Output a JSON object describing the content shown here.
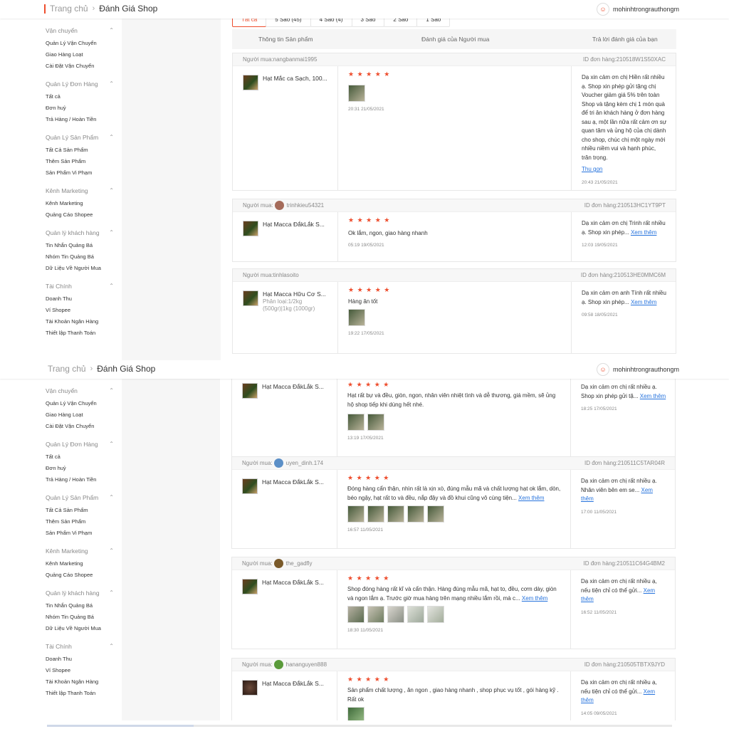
{
  "breadcrumb": {
    "home": "Trang chủ",
    "current": "Đánh Giá Shop"
  },
  "user": {
    "name": "mohinhtrongrauthongm"
  },
  "sidebar": [
    {
      "title": "Vận chuyển",
      "items": [
        "Quản Lý Vận Chuyển",
        "Giao Hàng Loạt",
        "Cài Đặt Vận Chuyển"
      ]
    },
    {
      "title": "Quản Lý Đơn Hàng",
      "items": [
        "Tất cả",
        "Đơn huỷ",
        "Trả Hàng / Hoàn Tiền"
      ]
    },
    {
      "title": "Quản Lý Sản Phẩm",
      "items": [
        "Tất Cả Sản Phẩm",
        "Thêm Sản Phẩm",
        "Sản Phẩm Vi Phạm"
      ]
    },
    {
      "title": "Kênh Marketing",
      "items": [
        "Kênh Marketing",
        "Quảng Cáo Shopee"
      ]
    },
    {
      "title": "Quản lý khách hàng",
      "items": [
        "Tin Nhắn Quảng Bá",
        "Nhóm Tin Quảng Bá",
        "Dữ Liệu Về Người Mua"
      ]
    },
    {
      "title": "Tài Chính",
      "items": [
        "Doanh Thu",
        "Ví Shopee",
        "Tài Khoản Ngân Hàng",
        "Thiết lập Thanh Toán"
      ]
    }
  ],
  "tabs": [
    "Tất cả",
    "5 Sao (45)",
    "4 Sao (4)",
    "3 Sao",
    "2 Sao",
    "1 Sao"
  ],
  "table_header": {
    "product": "Thông tin Sản phẩm",
    "buyer_review": "Đánh giá của Người mua",
    "reply": "Trả lời đánh giá của bạn"
  },
  "stars": "★ ★ ★ ★ ★",
  "more_label": "Xem thêm",
  "collapse_label": "Thu gọn",
  "reviews_top": [
    {
      "buyer": "Người mua:nangbanmai1995",
      "order": "ID đơn hàng:210518W1S50XAC",
      "product": "Hạt Mắc ca Sạch, 100...",
      "variant": "",
      "comment": "",
      "comment_more": false,
      "images": 1,
      "time": "20:31 21/05/2021",
      "reply": "Dạ xin cảm ơn chị Hiền rất nhiều ạ. Shop xin phép gửi tặng chị Voucher giảm giá 5% trên toàn Shop và tặng kèm chị 1 món quà để tri ân khách hàng ở đơn hàng sau ạ, một lần nữa rất cảm ơn sự quan tâm và ủng hộ của chị dành cho shop, chúc chị một ngày mới nhiều niềm vui và hạnh phúc, trăn trọng.",
      "reply_more": false,
      "reply_collapse": true,
      "reply_time": "20:43 21/05/2021"
    },
    {
      "buyer": "Người mua:",
      "buyer_name": "trinhkieu54321",
      "order": "ID đơn hàng:210513HC1YT9PT",
      "product": "Hạt Macca ĐắkLắk S...",
      "variant": "",
      "comment": "Ok lắm, ngon, giao hàng nhanh",
      "comment_more": false,
      "images": 0,
      "time": "05:19 19/05/2021",
      "reply": "Dạ xin cảm ơn chị Trinh rất nhiều ạ. Shop xin phép...",
      "reply_more": true,
      "reply_collapse": false,
      "reply_time": "12:03 19/05/2021"
    },
    {
      "buyer": "Người mua:tinhlasoito",
      "order": "ID đơn hàng:210513HE0MMC6M",
      "product": "Hạt Macca Hữu Cơ S...",
      "variant": "Phân loại:1/2kg (500gr)|1kg (1000gr)",
      "comment": "Hàng ăn tốt",
      "comment_more": false,
      "images": 1,
      "time": "19:22 17/05/2021",
      "reply": "Dạ xin cảm ơn anh Tính rất nhiều ạ. Shop xin phép...",
      "reply_more": true,
      "reply_collapse": false,
      "reply_time": "09:58 18/05/2021"
    }
  ],
  "reviews_bottom": [
    {
      "buyer": "",
      "order": "",
      "product": "Hạt Macca ĐắkLắk S...",
      "variant": "",
      "comment": "Hạt rất bự và đều, giòn, ngon, nhân viên nhiệt tình và dễ thương, giá mềm, sẽ ủng hộ shop tiếp khi dùng hết nhé.",
      "comment_more": false,
      "images": 2,
      "time": "13:19 17/05/2021",
      "reply": "Dạ xin cảm ơn chị rất nhiều ạ. Shop xin phép gửi tặ...",
      "reply_more": true,
      "reply_collapse": false,
      "reply_time": "18:25 17/05/2021"
    },
    {
      "buyer": "Người mua:",
      "buyer_name": "uyen_dinh.174",
      "order": "ID đơn hàng:210511C5TAR04R",
      "product": "Hạt Macca ĐắkLắk S...",
      "variant": "",
      "comment": "Đóng hàng cẩn thận, nhìn rất là xịn xò, đúng mẫu mã và chất lượng hạt ok lắm, dòn, béo ngậy, hạt rất to và đều, nắp đậy và đồ khui cũng vô cùng tiện...",
      "comment_more": true,
      "images": 5,
      "time": "16:57 11/05/2021",
      "reply": "Dạ xin cảm ơn chị rất nhiều ạ. Nhân viên bên em se...",
      "reply_more": true,
      "reply_collapse": false,
      "reply_time": "17:00 11/05/2021"
    },
    {
      "buyer": "Người mua:",
      "buyer_name": "the_gadfly",
      "order": "ID đơn hàng:210511C64G4BM2",
      "product": "Hạt Macca ĐắkLắk S...",
      "variant": "",
      "comment": "Shop đóng hàng rất kĩ và cẩn thận. Hàng đúng mẫu mã, hạt to, đều, cơm dày, giòn và ngon lắm ạ. Trước giờ mua hàng trên mạng nhiều lắm rồi, mà c...",
      "comment_more": true,
      "images": 5,
      "time": "18:30 11/05/2021",
      "reply": "Dạ xin cảm ơn chị rất nhiều ạ, nếu tiện chỉ có thể gửi...",
      "reply_more": true,
      "reply_collapse": false,
      "reply_time": "16:52 11/05/2021"
    },
    {
      "buyer": "Người mua:",
      "buyer_name": "hananguyen888",
      "order": "ID đơn hàng:210505TBTX9JYD",
      "product": "Hạt Macca ĐắkLắk S...",
      "variant": "",
      "comment": "Sản phẩm chất lượng , ăn ngon , giao hàng nhanh , shop phục vụ tốt , gói hàng kỹ . Rất ok",
      "comment_more": false,
      "images": 1,
      "time": "",
      "reply": "Dạ xin cảm ơn chị rất nhiều ạ, nếu tiện chỉ có thể gửi...",
      "reply_more": true,
      "reply_collapse": false,
      "reply_time": "14:05 09/05/2021"
    }
  ]
}
